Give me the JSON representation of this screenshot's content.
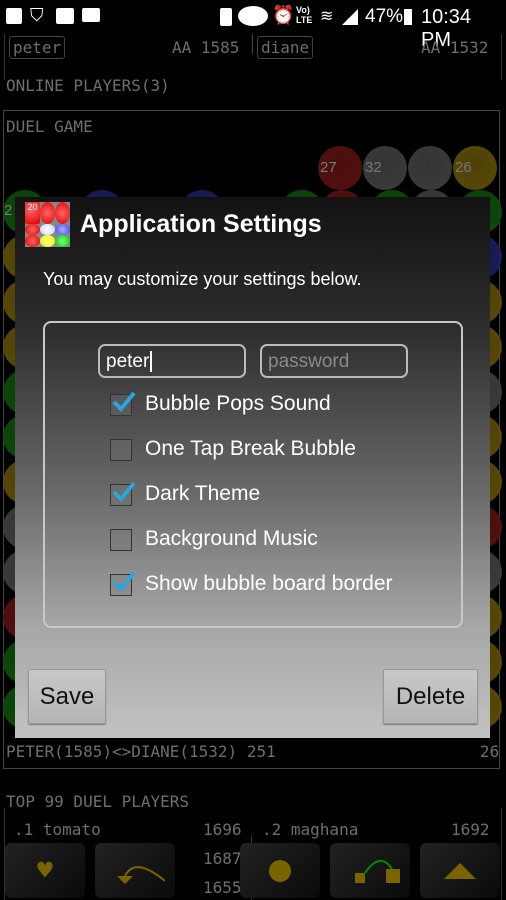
{
  "status_bar": {
    "battery": "47%",
    "time": "10:34 PM",
    "network": "LTE"
  },
  "players": {
    "left": {
      "name": "peter",
      "rating": "AA 1585"
    },
    "right": {
      "name": "diane",
      "rating": "AA 1532"
    }
  },
  "online_players": "ONLINE PLAYERS(3)",
  "duel_game": {
    "title": "DUEL GAME",
    "bubble_numbers": [
      "27",
      "32",
      "26"
    ],
    "side_number": "2",
    "footer": "PETER(1585)<>DIANE(1532) 251",
    "footer_right": "26"
  },
  "top_players": {
    "title": "TOP 99 DUEL PLAYERS",
    "rows": [
      {
        "rank": ".1 tomato",
        "score": "1696"
      },
      {
        "rank": ".2 maghana",
        "score": "1692"
      }
    ],
    "partial_scores": [
      "1687",
      "1655"
    ]
  },
  "dialog": {
    "icon_number": "20",
    "title": "Application Settings",
    "subtitle": "You may customize your settings below.",
    "username_value": "peter",
    "password_placeholder": "password",
    "options": [
      {
        "label": "Bubble Pops Sound",
        "checked": true
      },
      {
        "label": "One Tap Break Bubble",
        "checked": false
      },
      {
        "label": "Dark Theme",
        "checked": true
      },
      {
        "label": "Background Music",
        "checked": false
      },
      {
        "label": "Show bubble board border",
        "checked": true
      }
    ],
    "save_label": "Save",
    "delete_label": "Delete"
  },
  "toolbar": {
    "icons": [
      "heart-icon",
      "undo-arrow-icon",
      "circle-icon",
      "link-shapes-icon",
      "triangle-up-icon"
    ],
    "accent": "#7a6400"
  }
}
